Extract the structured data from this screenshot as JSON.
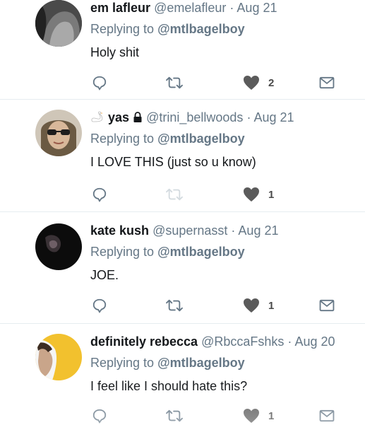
{
  "replies": [
    {
      "display_name": "em lafleur",
      "handle": "@emelafleur",
      "separator": "·",
      "date": "Aug 21",
      "replying_prefix": "Replying to",
      "replying_to": "@mtlbagelboy",
      "text": "Holy shit",
      "likes": "2"
    },
    {
      "display_name": "yas",
      "handle": "@trini_bellwoods",
      "separator": "·",
      "date": "Aug 21",
      "replying_prefix": "Replying to",
      "replying_to": "@mtlbagelboy",
      "text": "I LOVE THIS (just so u know)",
      "likes": "1"
    },
    {
      "display_name": "kate kush",
      "handle": "@supernasst",
      "separator": "·",
      "date": "Aug 21",
      "replying_prefix": "Replying to",
      "replying_to": "@mtlbagelboy",
      "text": "JOE.",
      "likes": "1"
    },
    {
      "display_name": "definitely rebecca",
      "handle": "@RbccaFshks",
      "separator": "·",
      "date": "Aug 20",
      "replying_prefix": "Replying to",
      "replying_to": "@mtlbagelboy",
      "text": "I feel like I should hate this?",
      "likes": "1"
    }
  ],
  "colors": {
    "icon_gray": "#657786",
    "heart": "#5b5b5b",
    "divider": "#e6ecf0"
  }
}
